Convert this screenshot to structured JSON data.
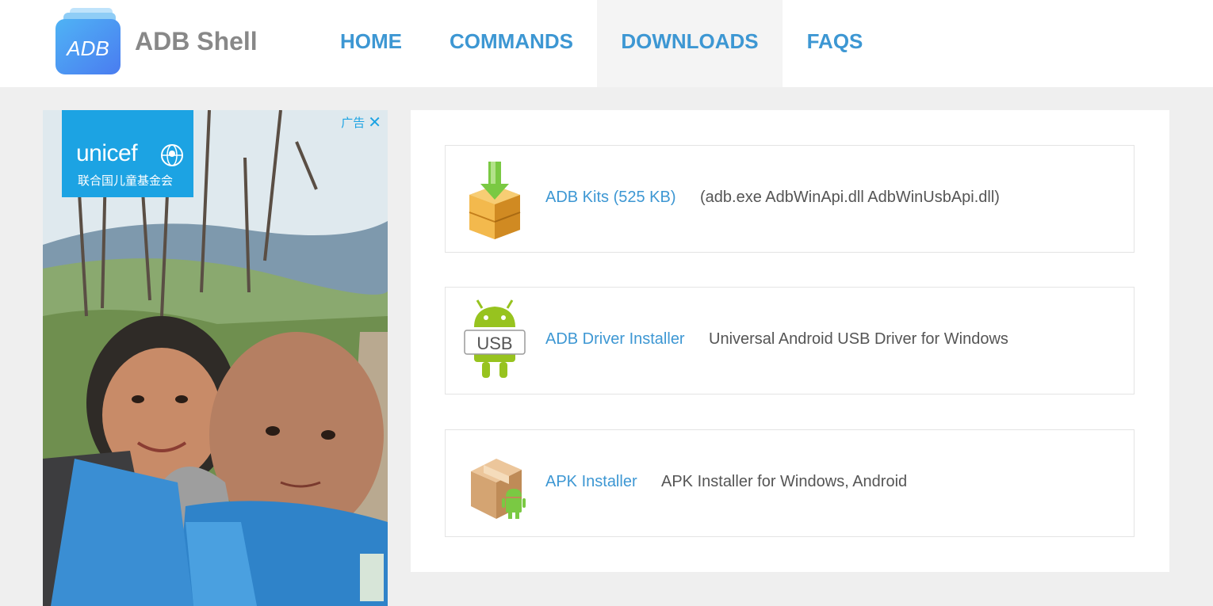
{
  "header": {
    "logo_text": "ADB",
    "site_title": "ADB Shell",
    "nav": [
      {
        "label": "HOME"
      },
      {
        "label": "COMMANDS"
      },
      {
        "label": "DOWNLOADS"
      },
      {
        "label": "FAQS"
      }
    ],
    "active_nav": "DOWNLOADS"
  },
  "ad": {
    "brand_name": "unicef",
    "brand_subtitle": "联合国儿童基金会",
    "ad_label": "广告",
    "close_icon": "close-icon"
  },
  "downloads": [
    {
      "title": "ADB Kits (525 KB)",
      "description": "(adb.exe AdbWinApi.dll AdbWinUsbApi.dll)",
      "icon": "download-box-icon"
    },
    {
      "title": "ADB Driver Installer",
      "description": "Universal Android USB Driver for Windows",
      "icon": "android-usb-icon"
    },
    {
      "title": "APK Installer",
      "description": "APK Installer for Windows, Android",
      "icon": "apk-package-icon"
    }
  ],
  "colors": {
    "accent": "#3d97d3",
    "background": "#efefef",
    "unicef_blue": "#1ca3e3"
  }
}
